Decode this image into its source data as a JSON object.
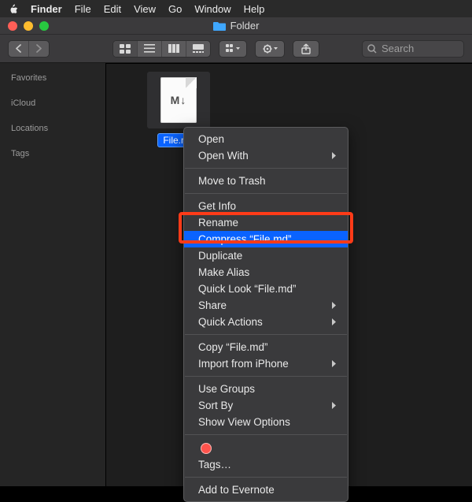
{
  "menubar": {
    "app": "Finder",
    "items": [
      "File",
      "Edit",
      "View",
      "Go",
      "Window",
      "Help"
    ]
  },
  "titlebar": {
    "title": "Folder"
  },
  "toolbar": {
    "search_placeholder": "Search"
  },
  "sidebar": {
    "sections": [
      "Favorites",
      "iCloud",
      "Locations",
      "Tags"
    ]
  },
  "file": {
    "name": "File.md",
    "glyph": "M↓"
  },
  "context_menu": {
    "groups": [
      [
        {
          "label": "Open",
          "submenu": false
        },
        {
          "label": "Open With",
          "submenu": true
        }
      ],
      [
        {
          "label": "Move to Trash",
          "submenu": false
        }
      ],
      [
        {
          "label": "Get Info",
          "submenu": false
        },
        {
          "label": "Rename",
          "submenu": false
        },
        {
          "label": "Compress “File.md”",
          "submenu": false,
          "highlighted": true
        },
        {
          "label": "Duplicate",
          "submenu": false
        },
        {
          "label": "Make Alias",
          "submenu": false
        },
        {
          "label": "Quick Look “File.md”",
          "submenu": false
        },
        {
          "label": "Share",
          "submenu": true
        },
        {
          "label": "Quick Actions",
          "submenu": true
        }
      ],
      [
        {
          "label": "Copy “File.md”",
          "submenu": false
        },
        {
          "label": "Import from iPhone",
          "submenu": true
        }
      ],
      [
        {
          "label": "Use Groups",
          "submenu": false
        },
        {
          "label": "Sort By",
          "submenu": true
        },
        {
          "label": "Show View Options",
          "submenu": false
        }
      ],
      [
        {
          "type": "tag-swatch"
        },
        {
          "label": "Tags…",
          "submenu": false
        }
      ],
      [
        {
          "label": "Add to Evernote",
          "submenu": false
        }
      ]
    ]
  },
  "annotation": {
    "highlighted_item": "Compress “File.md”"
  }
}
